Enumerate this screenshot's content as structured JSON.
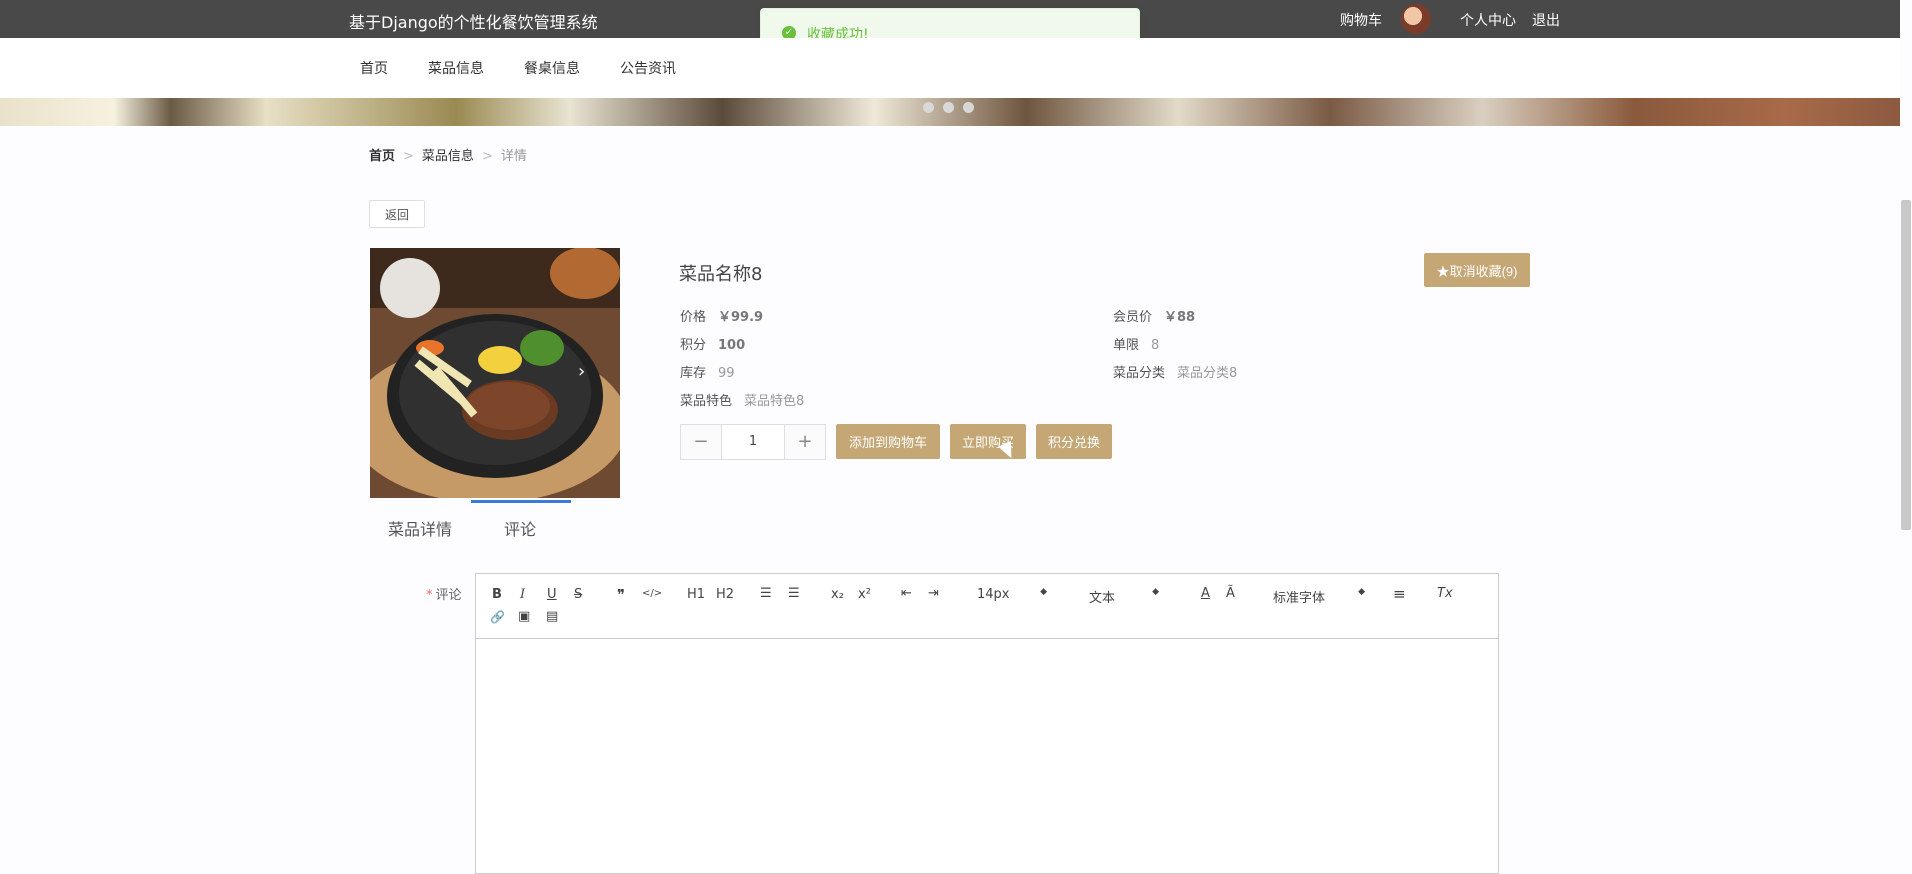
{
  "header": {
    "site_title": "基于Django的个性化餐饮管理系统",
    "cart": "购物车",
    "profile": "个人中心",
    "logout": "退出"
  },
  "toast": {
    "message": "收藏成功!"
  },
  "nav": {
    "items": [
      "首页",
      "菜品信息",
      "餐桌信息",
      "公告资讯"
    ]
  },
  "breadcrumb": {
    "home": "首页",
    "section": "菜品信息",
    "current": "详情"
  },
  "back_label": "返回",
  "product": {
    "name": "菜品名称8",
    "favorite_label": "取消收藏(9)",
    "price_label": "价格",
    "price": "￥99.9",
    "member_price_label": "会员价",
    "member_price": "￥88",
    "points_label": "积分",
    "points": "100",
    "limit_label": "单限",
    "limit": "8",
    "stock_label": "库存",
    "stock": "99",
    "category_label": "菜品分类",
    "category": "菜品分类8",
    "feature_label": "菜品特色",
    "feature": "菜品特色8",
    "quantity": "1",
    "quantity_minus": "−",
    "quantity_plus": "+",
    "add_to_cart": "添加到购物车",
    "buy_now": "立即购买",
    "points_exchange": "积分兑换"
  },
  "tabs": {
    "details": "菜品详情",
    "comments": "评论"
  },
  "comment_form": {
    "required_mark": "*",
    "label": "评论",
    "toolbar": {
      "bold": "B",
      "italic": "I",
      "underline": "U",
      "strike": "S",
      "quote": "❞",
      "code": "</>",
      "h1": "H1",
      "h2": "H2",
      "ordered": "☰",
      "bullet": "☰",
      "sub": "x₂",
      "sup": "x²",
      "outdent": "⇤",
      "indent": "⇥",
      "size": "14px",
      "type": "文本",
      "color": "A",
      "bg": "Ã",
      "font": "标准字体",
      "align": "≡",
      "clear": "Tx",
      "link": "🔗",
      "image": "▣",
      "video": "▤"
    }
  },
  "colors": {
    "accent": "#c4a774",
    "topbar": "#4a4949",
    "success": "#67c23a",
    "tab_active": "#3a7bd5"
  }
}
